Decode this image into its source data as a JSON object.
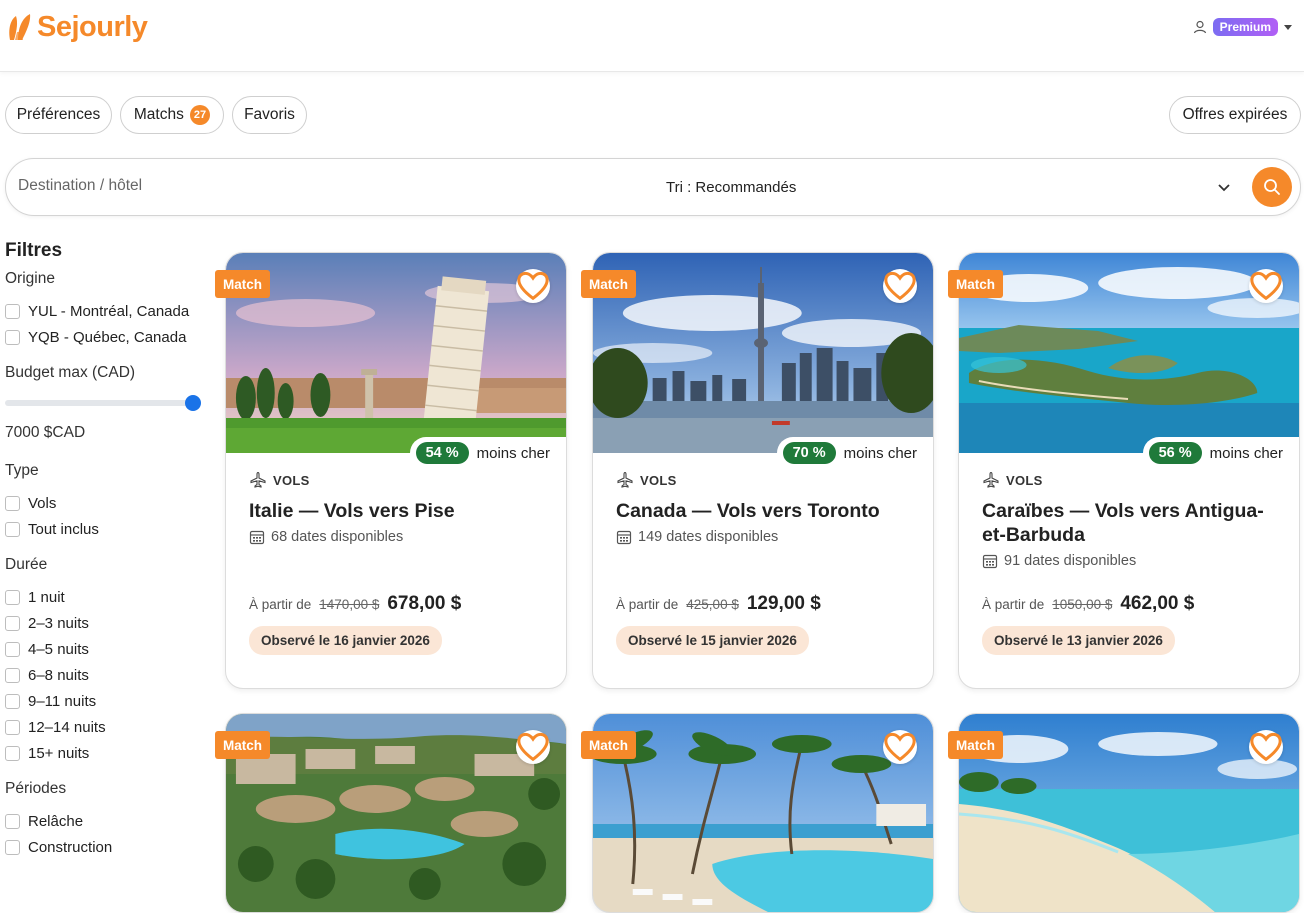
{
  "header": {
    "brand": "Sejourly",
    "premium_label": "Premium"
  },
  "nav": {
    "preferences": "Préférences",
    "matches": "Matchs",
    "matches_count": "27",
    "favorites": "Favoris",
    "expired": "Offres expirées"
  },
  "search": {
    "placeholder": "Destination / hôtel",
    "sort_label": "Tri : Recommandés"
  },
  "filters": {
    "title": "Filtres",
    "origin_heading": "Origine",
    "origins": [
      "YUL - Montréal, Canada",
      "YQB - Québec, Canada"
    ],
    "budget_heading": "Budget max (CAD)",
    "budget_value": "7000 $CAD",
    "budget_level": 1.0,
    "type_heading": "Type",
    "types": [
      "Vols",
      "Tout inclus"
    ],
    "duration_heading": "Durée",
    "durations": [
      "1 nuit",
      "2–3 nuits",
      "4–5 nuits",
      "6–8 nuits",
      "9–11 nuits",
      "12–14 nuits",
      "15+ nuits"
    ],
    "periods_heading": "Périodes",
    "periods": [
      "Relâche",
      "Construction"
    ]
  },
  "cards": [
    {
      "match": "Match",
      "discount": "54 %",
      "discount_suffix": "moins cher",
      "type": "VOLS",
      "title": "Italie — Vols vers Pise",
      "dates": "68 dates disponibles",
      "from": "À partir de",
      "old_price": "1470,00 $",
      "price": "678,00 $",
      "observed": "Observé le 16 janvier 2026"
    },
    {
      "match": "Match",
      "discount": "70 %",
      "discount_suffix": "moins cher",
      "type": "VOLS",
      "title": "Canada — Vols vers Toronto",
      "dates": "149 dates disponibles",
      "from": "À partir de",
      "old_price": "425,00 $",
      "price": "129,00 $",
      "observed": "Observé le 15 janvier 2026"
    },
    {
      "match": "Match",
      "discount": "56 %",
      "discount_suffix": "moins cher",
      "type": "VOLS",
      "title": "Caraïbes — Vols vers Antigua-et-Barbuda",
      "dates": "91 dates disponibles",
      "from": "À partir de",
      "old_price": "1050,00 $",
      "price": "462,00 $",
      "observed": "Observé le 13 janvier 2026"
    },
    {
      "match": "Match"
    },
    {
      "match": "Match"
    },
    {
      "match": "Match"
    }
  ],
  "colors": {
    "brand_orange": "#f5892a",
    "discount_green": "#1f7a3a",
    "observed_bg": "#fbe6d6",
    "premium_gradient_start": "#7c6cf2",
    "premium_gradient_end": "#b15ff5",
    "slider_blue": "#1a73e8"
  }
}
